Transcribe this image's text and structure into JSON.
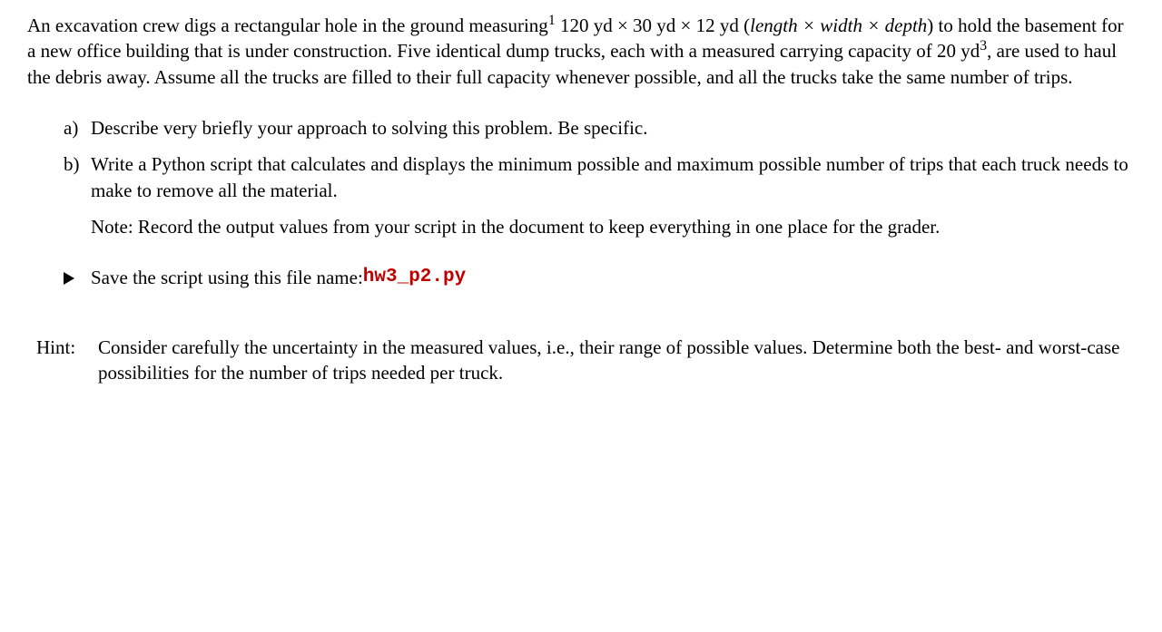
{
  "problem": {
    "text_before_sup1": "An excavation crew digs a rectangular hole in the ground measuring",
    "sup1": "1",
    "dimensions": " 120 yd × 30 yd × 12 yd (",
    "italic_dims": "length × width × depth",
    "text_mid": ") to hold the basement for a new office building that is under construction. Five identical dump trucks, each with a measured carrying capacity of 20 yd",
    "sup3": "3",
    "text_after": ", are used to haul the debris away. Assume all the trucks are filled to their full capacity whenever possible, and all the trucks take the same number of trips."
  },
  "parts": {
    "a": {
      "label": "a)",
      "text": "Describe very briefly your approach to solving this problem. Be specific."
    },
    "b": {
      "label": "b)",
      "text": "Write a Python script that calculates and displays the minimum possible and maximum possible number of trips that each truck needs to make to remove all the material.",
      "note": "Note: Record the output values from your script in the document to keep everything in one place for the grader."
    }
  },
  "save": {
    "text": "Save the script using this file name: ",
    "filename": "hw3_p2.py"
  },
  "hint": {
    "label": "Hint:",
    "text": "Consider carefully the uncertainty in the measured values, i.e., their range of possible values. Determine both the best- and worst-case possibilities for the number of trips needed per truck."
  }
}
